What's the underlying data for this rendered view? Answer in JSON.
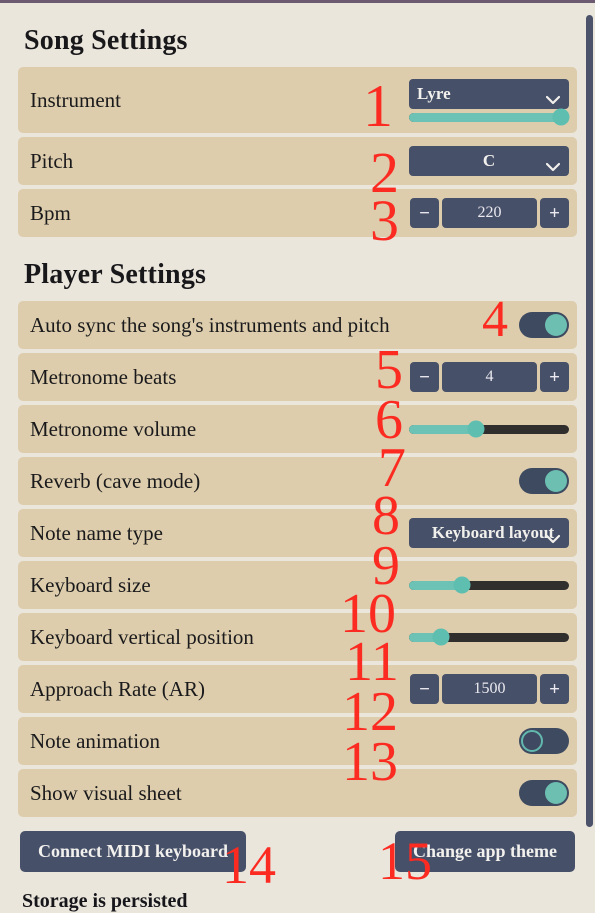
{
  "app": {
    "accent_teal": "#6cc2b4",
    "control_navy": "#465069",
    "row_bg": "#ddcdac",
    "page_bg": "#ebe6dc",
    "annotation_color": "#fb2b22"
  },
  "song_settings": {
    "title": "Song Settings",
    "rows": [
      {
        "label": "Instrument",
        "control": "select-with-slider",
        "value": "Lyre",
        "slider_percent": 95,
        "annotation": "1"
      },
      {
        "label": "Pitch",
        "control": "select",
        "value": "C",
        "annotation": "2"
      },
      {
        "label": "Bpm",
        "control": "stepper",
        "value": "220",
        "minus_label": "−",
        "plus_label": "+",
        "annotation": "3"
      }
    ]
  },
  "player_settings": {
    "title": "Player Settings",
    "rows": [
      {
        "label": "Auto sync the song's instruments and pitch",
        "control": "toggle",
        "state": "on",
        "annotation": "4"
      },
      {
        "label": "Metronome beats",
        "control": "stepper",
        "value": "4",
        "minus_label": "−",
        "plus_label": "+",
        "annotation": "5"
      },
      {
        "label": "Metronome volume",
        "control": "slider",
        "slider_percent": 42,
        "annotation": "6"
      },
      {
        "label": "Reverb (cave mode)",
        "control": "toggle",
        "state": "on",
        "annotation": "7"
      },
      {
        "label": "Note name type",
        "control": "select",
        "value": "Keyboard layout",
        "annotation": "8"
      },
      {
        "label": "Keyboard size",
        "control": "slider",
        "slider_percent": 33,
        "annotation": "9"
      },
      {
        "label": "Keyboard vertical position",
        "control": "slider",
        "slider_percent": 20,
        "annotation": "10"
      },
      {
        "label": "Approach Rate (AR)",
        "control": "stepper",
        "value": "1500",
        "minus_label": "−",
        "plus_label": "+",
        "annotation": "11"
      },
      {
        "label": "Note animation",
        "control": "toggle",
        "state": "off",
        "annotation": "12"
      },
      {
        "label": "Show visual sheet",
        "control": "toggle",
        "state": "on",
        "annotation": "13"
      }
    ]
  },
  "footer": {
    "midi_button": "Connect MIDI keyboard",
    "theme_button": "Change app theme",
    "storage_status": "Storage is persisted",
    "midi_annotation": "14",
    "theme_annotation": "15"
  }
}
